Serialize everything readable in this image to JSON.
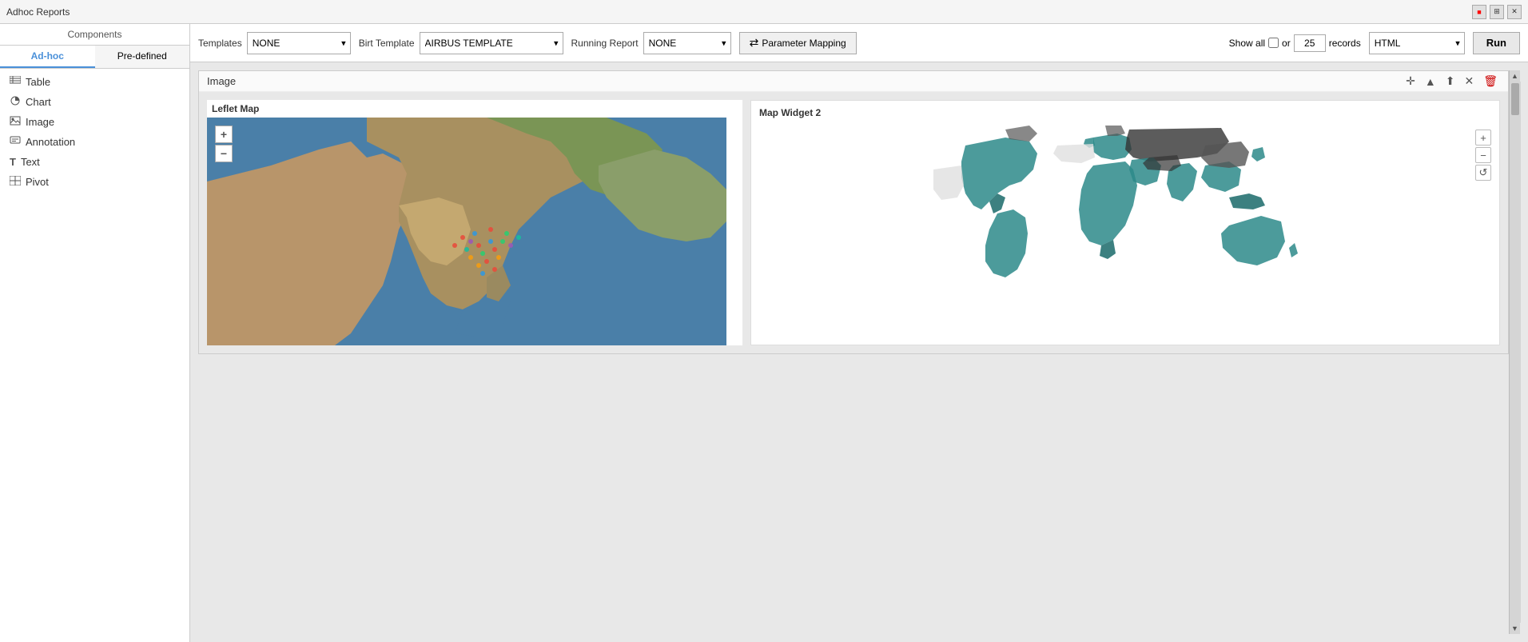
{
  "titlebar": {
    "title": "Adhoc Reports",
    "controls": [
      "minimize",
      "maximize",
      "close"
    ]
  },
  "sidebar": {
    "header": "Components",
    "tabs": [
      {
        "id": "adhoc",
        "label": "Ad-hoc"
      },
      {
        "id": "predefined",
        "label": "Pre-defined"
      }
    ],
    "items": [
      {
        "id": "table",
        "label": "Table",
        "icon": "☰"
      },
      {
        "id": "chart",
        "label": "Chart",
        "icon": "◔"
      },
      {
        "id": "image",
        "label": "Image",
        "icon": "🖼"
      },
      {
        "id": "annotation",
        "label": "Annotation",
        "icon": "✎"
      },
      {
        "id": "text",
        "label": "Text",
        "icon": "T"
      },
      {
        "id": "pivot",
        "label": "Pivot",
        "icon": "⊞"
      }
    ]
  },
  "toolbar": {
    "templates_label": "Templates",
    "templates_value": "NONE",
    "birt_label": "Birt Template",
    "birt_value": "AIRBUS TEMPLATE",
    "running_label": "Running Report",
    "running_value": "NONE",
    "param_mapping": "Parameter Mapping",
    "show_all": "Show all",
    "or_text": "or",
    "records_value": "25",
    "records_label": "records",
    "format_value": "HTML",
    "run_label": "Run"
  },
  "report_area": {
    "image_block": {
      "title": "Image",
      "leaflet_map": {
        "label": "Leflet Map",
        "zoom_in": "+",
        "zoom_out": "−"
      },
      "map_widget2": {
        "label": "Map Widget 2",
        "zoom_in": "+",
        "zoom_out": "−",
        "refresh": "↺"
      }
    }
  }
}
